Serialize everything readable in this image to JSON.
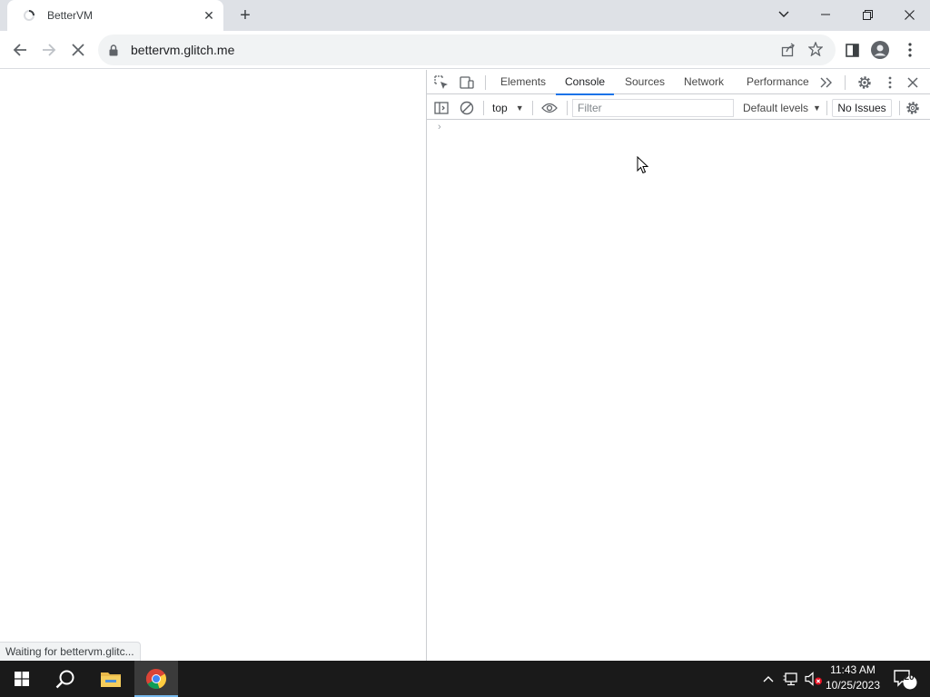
{
  "browser": {
    "tab": {
      "title": "BetterVM",
      "close_glyph": "✕"
    },
    "new_tab_glyph": "+",
    "window_controls": {
      "tab_search_icon": "chevron-down-icon",
      "minimize_icon": "minimize-icon",
      "restore_icon": "restore-icon",
      "close_icon": "close-icon"
    },
    "toolbar": {
      "url": "bettervm.glitch.me",
      "back_icon": "arrow-left-icon",
      "forward_icon": "arrow-right-icon",
      "stop_icon": "close-icon",
      "lock_icon": "lock-icon",
      "share_icon": "share-icon",
      "bookmark_icon": "star-icon",
      "side_panel_icon": "side-panel-icon",
      "profile_icon": "profile-icon",
      "menu_icon": "vertical-dots-icon"
    },
    "status_text": "Waiting for bettervm.glitc..."
  },
  "devtools": {
    "tabs": [
      {
        "label": "Elements",
        "active": false
      },
      {
        "label": "Console",
        "active": true
      },
      {
        "label": "Sources",
        "active": false
      },
      {
        "label": "Network",
        "active": false
      },
      {
        "label": "Performance",
        "active": false
      }
    ],
    "more_tabs_glyph": "»",
    "console": {
      "context": "top",
      "filter_placeholder": "Filter",
      "levels": "Default levels",
      "issues": "No Issues",
      "prompt_glyph": "›"
    }
  },
  "taskbar": {
    "clock_time": "11:43 AM",
    "clock_date": "10/25/2023",
    "notification_count": "20",
    "accent_color": "#76b9ed"
  },
  "colors": {
    "tabstrip": "#dee1e6",
    "active_tab_underline": "#1a73e8",
    "taskbar": "#1a1a1a"
  }
}
